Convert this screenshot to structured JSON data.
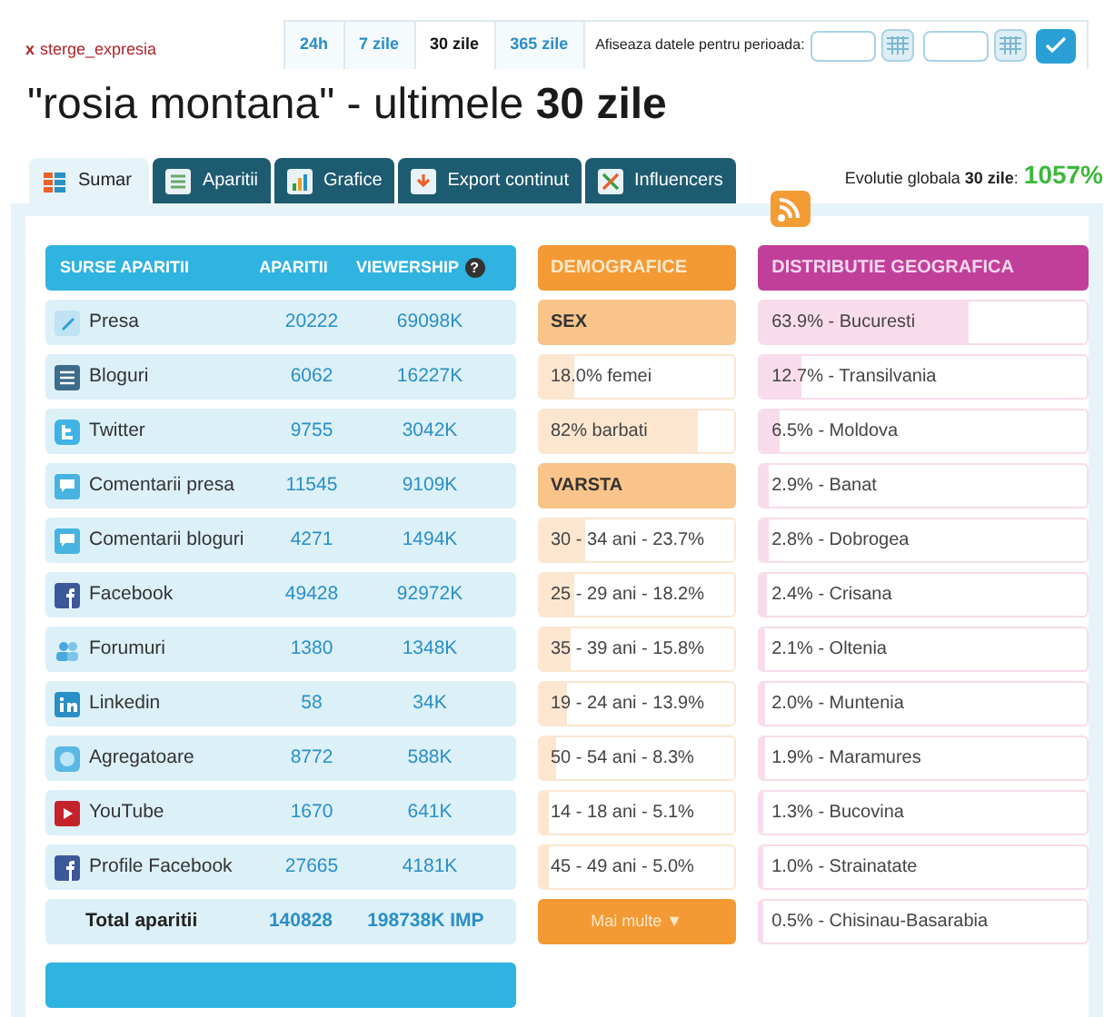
{
  "top_bar": {
    "clear_link": {
      "icon": "x",
      "label": "sterge_expresia"
    },
    "periods": [
      {
        "label": "24h",
        "selected": false
      },
      {
        "label": "7 zile",
        "selected": false
      },
      {
        "label": "30 zile",
        "selected": true
      },
      {
        "label": "365 zile",
        "selected": false
      }
    ],
    "range_label": "Afiseaza datele pentru perioada:"
  },
  "title": "\"rosia montana\" - ultimele **30 zile**",
  "tabs": [
    {
      "label": "Sumar",
      "selected": true
    },
    {
      "label": "Aparitii",
      "selected": false
    },
    {
      "label": "Grafice",
      "selected": false
    },
    {
      "label": "Export continut",
      "selected": false
    },
    {
      "label": "Influencers",
      "selected": false
    }
  ],
  "evolution": {
    "label": "Evolutie globala **30 zile**:",
    "value": "1057%"
  },
  "sources": {
    "columns": [
      "SURSE APARITII",
      "APARITII",
      "VIEWERSHIP"
    ],
    "help_icon": "?",
    "rows": [
      {
        "name": "Presa",
        "aparitii": "20222",
        "viewership": "69098K"
      },
      {
        "name": "Bloguri",
        "aparitii": "6062",
        "viewership": "16227K"
      },
      {
        "name": "Twitter",
        "aparitii": "9755",
        "viewership": "3042K"
      },
      {
        "name": "Comentarii presa",
        "aparitii": "11545",
        "viewership": "9109K"
      },
      {
        "name": "Comentarii bloguri",
        "aparitii": "4271",
        "viewership": "1494K"
      },
      {
        "name": "Facebook",
        "aparitii": "49428",
        "viewership": "92972K"
      },
      {
        "name": "Forumuri",
        "aparitii": "1380",
        "viewership": "1348K"
      },
      {
        "name": "Linkedin",
        "aparitii": "58",
        "viewership": "34K"
      },
      {
        "name": "Agregatoare",
        "aparitii": "8772",
        "viewership": "588K"
      },
      {
        "name": "YouTube",
        "aparitii": "1670",
        "viewership": "641K"
      },
      {
        "name": "Profile Facebook",
        "aparitii": "27665",
        "viewership": "4181K"
      }
    ],
    "total": {
      "label": "Total aparitii",
      "aparitii": "140828",
      "viewership": "198738K IMP"
    }
  },
  "demographics": {
    "title": "DEMOGRAFICE",
    "rows": [
      {
        "kind": "heading",
        "label": "SEX"
      },
      {
        "kind": "bar",
        "label": "18.0% femei",
        "level": 0.18
      },
      {
        "kind": "bar",
        "label": "82% barbati",
        "level": 0.82
      },
      {
        "kind": "heading",
        "label": "VARSTA"
      },
      {
        "kind": "bar",
        "label": "30 - 34 ani - 23.7%",
        "level": 0.237
      },
      {
        "kind": "bar",
        "label": "25 - 29 ani - 18.2%",
        "level": 0.182
      },
      {
        "kind": "bar",
        "label": "35 - 39 ani - 15.8%",
        "level": 0.158
      },
      {
        "kind": "bar",
        "label": "19 - 24 ani - 13.9%",
        "level": 0.139
      },
      {
        "kind": "bar",
        "label": "50 - 54 ani - 8.3%",
        "level": 0.083
      },
      {
        "kind": "bar",
        "label": "14 - 18 ani - 5.1%",
        "level": 0.051
      },
      {
        "kind": "bar",
        "label": "45 - 49 ani - 5.0%",
        "level": 0.05
      }
    ],
    "more_button": "Mai multe ▼"
  },
  "geography": {
    "title": "DISTRIBUTIE GEOGRAFICA",
    "rows": [
      {
        "label": "63.9% - Bucuresti",
        "level": 0.639
      },
      {
        "label": "12.7% - Transilvania",
        "level": 0.127
      },
      {
        "label": "6.5% - Moldova",
        "level": 0.065
      },
      {
        "label": "2.9% - Banat",
        "level": 0.029
      },
      {
        "label": "2.8% - Dobrogea",
        "level": 0.028
      },
      {
        "label": "2.4% - Crisana",
        "level": 0.024
      },
      {
        "label": "2.1% - Oltenia",
        "level": 0.021
      },
      {
        "label": "2.0% - Muntenia",
        "level": 0.02
      },
      {
        "label": "1.9% - Maramures",
        "level": 0.019
      },
      {
        "label": "1.3% - Bucovina",
        "level": 0.013
      },
      {
        "label": "1.0% - Strainatate",
        "level": 0.01
      },
      {
        "label": "0.5% - Chisinau-Basarabia",
        "level": 0.005
      }
    ]
  }
}
